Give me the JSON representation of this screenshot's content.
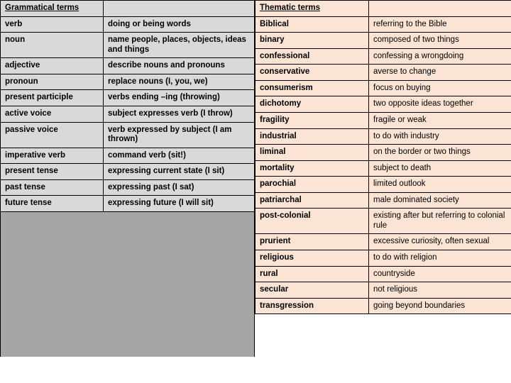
{
  "page": {
    "background_color": "#ffffff",
    "left_table_color": "#d9d9d9",
    "right_table_color": "#fbe4d3",
    "filler_color": "#a6a6a6",
    "border_color": "#000000"
  },
  "grammatical": {
    "header": "Grammatical terms",
    "rows": [
      {
        "term": "verb",
        "definition": "doing or being words"
      },
      {
        "term": "noun",
        "definition": "name people, places, objects, ideas and things"
      },
      {
        "term": "adjective",
        "definition": "describe nouns and pronouns"
      },
      {
        "term": "pronoun",
        "definition": "replace nouns (I, you, we)"
      },
      {
        "term": "present participle",
        "definition": "verbs ending –ing (throwing)"
      },
      {
        "term": "active voice",
        "definition": "subject expresses verb (I throw)"
      },
      {
        "term": "passive voice",
        "definition": "verb expressed by subject (I am thrown)"
      },
      {
        "term": "imperative verb",
        "definition": "command verb (sit!)"
      },
      {
        "term": "present tense",
        "definition": "expressing current state (I sit)"
      },
      {
        "term": "past tense",
        "definition": "expressing past (I sat)"
      },
      {
        "term": "future tense",
        "definition": "expressing future (I will sit)"
      }
    ]
  },
  "thematic": {
    "header": "Thematic terms",
    "rows": [
      {
        "term": "Biblical",
        "definition": "referring to the Bible",
        "tall": false
      },
      {
        "term": "binary",
        "definition": "composed of two things",
        "tall": true
      },
      {
        "term": "confessional",
        "definition": "confessing a wrongdoing",
        "tall": false
      },
      {
        "term": "conservative",
        "definition": "averse to change",
        "tall": false
      },
      {
        "term": "consumerism",
        "definition": "focus on buying",
        "tall": false
      },
      {
        "term": "dichotomy",
        "definition": "two opposite ideas together",
        "tall": false
      },
      {
        "term": "fragility",
        "definition": "fragile or weak",
        "tall": true
      },
      {
        "term": "industrial",
        "definition": "to do with industry",
        "tall": false
      },
      {
        "term": "liminal",
        "definition": "on the border or two things",
        "tall": false
      },
      {
        "term": "mortality",
        "definition": "subject to death",
        "tall": false
      },
      {
        "term": "parochial",
        "definition": "limited outlook",
        "tall": false
      },
      {
        "term": "patriarchal",
        "definition": "male dominated society",
        "tall": false
      },
      {
        "term": "post-colonial",
        "definition": "existing after but referring to colonial rule",
        "tall": false
      },
      {
        "term": "prurient",
        "definition": "excessive curiosity, often sexual",
        "tall": false
      },
      {
        "term": "religious",
        "definition": "to do with religion",
        "tall": false
      },
      {
        "term": "rural",
        "definition": "countryside",
        "tall": false
      },
      {
        "term": "secular",
        "definition": "not religious",
        "tall": false
      },
      {
        "term": "transgression",
        "definition": "going beyond boundaries",
        "tall": false
      }
    ]
  }
}
